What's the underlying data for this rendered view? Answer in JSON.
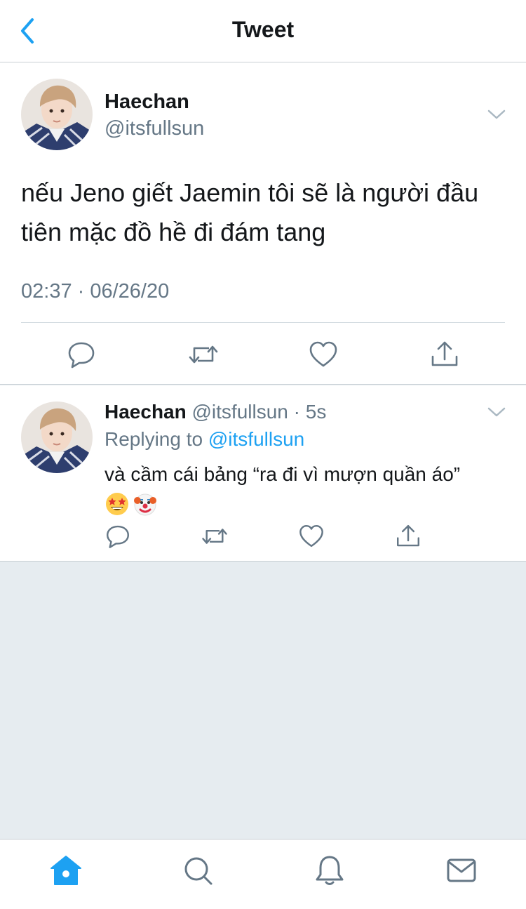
{
  "header": {
    "title": "Tweet"
  },
  "tweet": {
    "name": "Haechan",
    "handle": "@itsfullsun",
    "text": "nếu Jeno giết Jaemin tôi sẽ là người đầu tiên mặc đồ hề đi đám tang",
    "timestamp": "02:37 · 06/26/20"
  },
  "reply": {
    "name": "Haechan",
    "handle": "@itsfullsun",
    "separator": "·",
    "age": "5s",
    "replying_prefix": "Replying to",
    "replying_handle": "@itsfullsun",
    "text": "và cầm cái bảng “ra đi vì mượn quần áo”",
    "emojis": [
      "star-struck",
      "clown-face"
    ]
  },
  "actions": [
    "reply-icon",
    "retweet-icon",
    "like-icon",
    "share-icon"
  ],
  "tabs": [
    "home-icon",
    "search-icon",
    "notifications-icon",
    "messages-icon"
  ],
  "colors": {
    "accent": "#1da1f2",
    "secondary_text": "#657786",
    "icon": "#657786",
    "background": "#e6ecf0"
  }
}
